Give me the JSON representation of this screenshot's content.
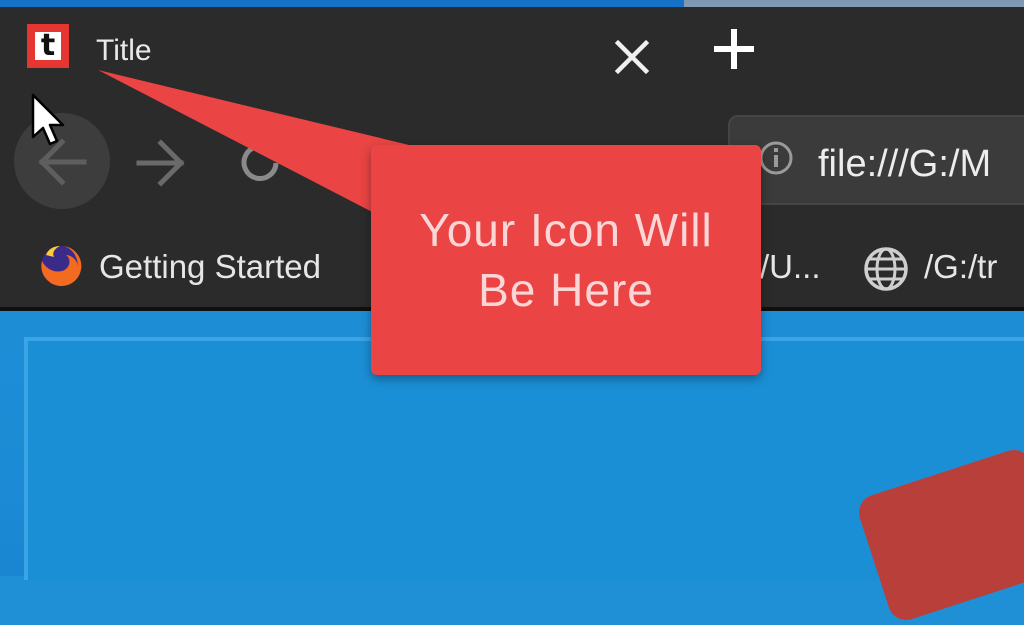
{
  "tab": {
    "favicon_letter": "t",
    "title": "Title"
  },
  "address_bar": {
    "url": "file:///G:/M"
  },
  "bookmarks": [
    {
      "label": "Getting Started",
      "icon": "firefox-icon"
    },
    {
      "label": "/U...",
      "icon": ""
    },
    {
      "label": "/G:/tr",
      "icon": "globe-icon"
    }
  ],
  "callout": {
    "line1": "Your Icon Will",
    "line2": "Be Here"
  },
  "colors": {
    "browser_dark": "#2b2b2b",
    "callout_red": "#ea4444",
    "favicon_red": "#e63632",
    "page_blue": "#1f8fd6"
  }
}
